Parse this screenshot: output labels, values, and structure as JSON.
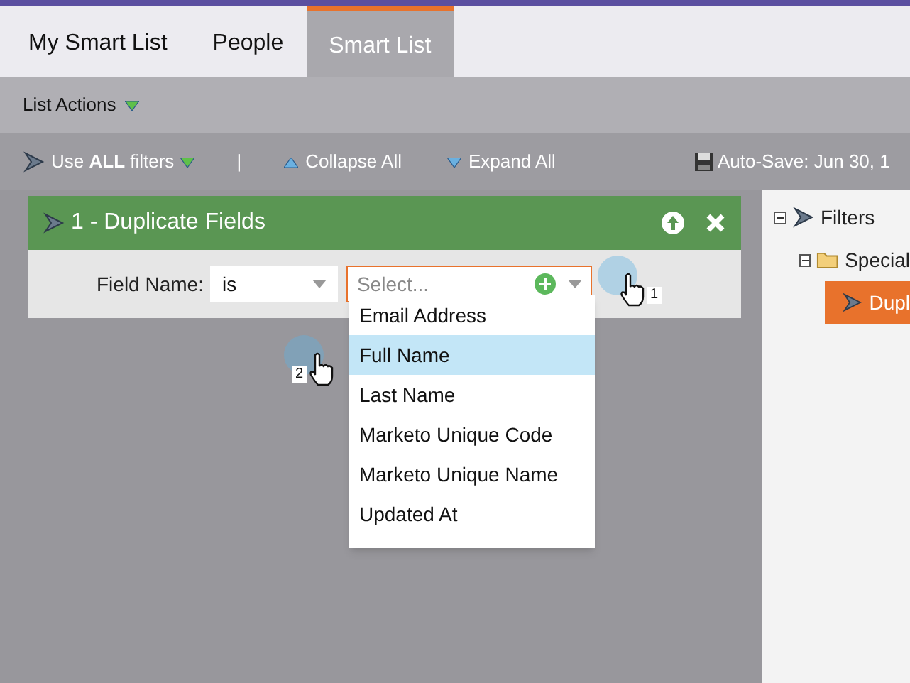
{
  "tabs": [
    {
      "label": "My Smart List",
      "selected": false
    },
    {
      "label": "People",
      "selected": false
    },
    {
      "label": "Smart List",
      "selected": true
    }
  ],
  "menu": {
    "label": "List Actions"
  },
  "toolbar": {
    "use_filters": "Use **ALL** filters",
    "separator": "|",
    "collapse": "Collapse All",
    "expand": "Expand All",
    "autosave": "Auto-Save: Jun 30, 1"
  },
  "filter": {
    "title": "1 - Duplicate Fields",
    "field_label": "Field Name:",
    "operator": "is",
    "value_placeholder": "Select...",
    "options": [
      {
        "label": "Email Address",
        "selected": false
      },
      {
        "label": "Full Name",
        "selected": true
      },
      {
        "label": "Last Name",
        "selected": false
      },
      {
        "label": "Marketo Unique Code",
        "selected": false
      },
      {
        "label": "Marketo Unique Name",
        "selected": false
      },
      {
        "label": "Updated At",
        "selected": false
      }
    ]
  },
  "callouts": [
    "1",
    "2"
  ],
  "tree": [
    {
      "label": "Filters",
      "kind": "filter",
      "expanded": true,
      "selected": false,
      "children": [
        {
          "label": "Special",
          "kind": "folder",
          "expanded": true,
          "selected": false,
          "children": [
            {
              "label": "Dupl",
              "kind": "filter",
              "selected": true
            }
          ]
        }
      ]
    }
  ]
}
